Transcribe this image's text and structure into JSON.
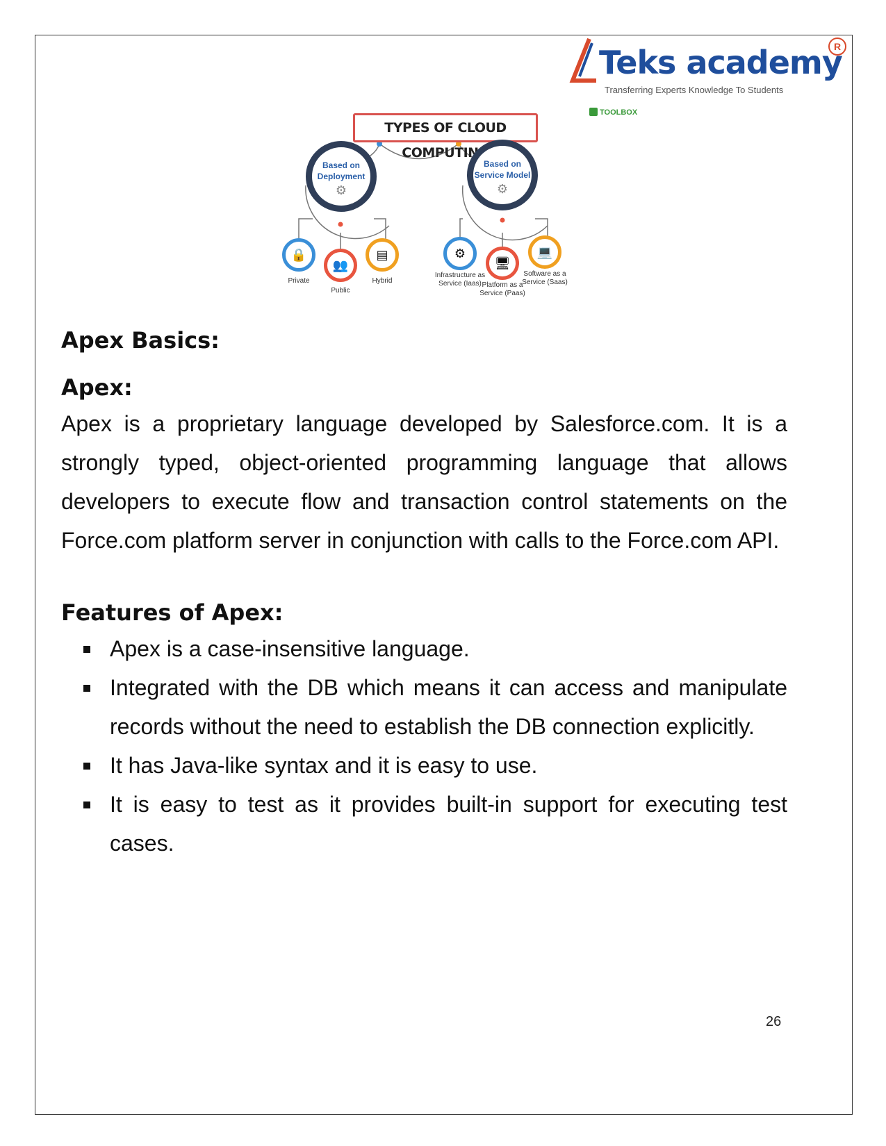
{
  "logo": {
    "name": "Teks academy",
    "tagline": "Transferring Experts Knowledge To Students",
    "registered": "R"
  },
  "figure": {
    "title": "TYPES OF CLOUD COMPUTING",
    "source": "TOOLBOX",
    "groups": [
      {
        "label": "Based on Deployment",
        "icon": "gear-icon",
        "items": [
          {
            "label": "Private",
            "icon": "lock-icon",
            "color": "#3a8fd8"
          },
          {
            "label": "Public",
            "icon": "people-icon",
            "color": "#e8553f"
          },
          {
            "label": "Hybrid",
            "icon": "server-icon",
            "color": "#f0a020"
          }
        ]
      },
      {
        "label": "Based on Service Model",
        "icon": "gear-icon",
        "items": [
          {
            "label": "Infrastructure as Service (Iaas)",
            "icon": "cog-icon",
            "color": "#3a8fd8"
          },
          {
            "label": "Platform as a Service (Paas)",
            "icon": "monitor-icon",
            "color": "#e8553f"
          },
          {
            "label": "Software as a Service (Saas)",
            "icon": "laptop-icon",
            "color": "#f0a020"
          }
        ]
      }
    ]
  },
  "section_title": "Apex Basics:",
  "apex_heading": "Apex:",
  "apex_paragraph": "Apex is a proprietary language developed by Salesforce.com. It is a strongly typed, object-oriented programming language that allows developers to execute flow and transaction control statements on the Force.com platform server in conjunction with calls to the Force.com API.",
  "features_heading": "Features of Apex:",
  "features": [
    "Apex is a case-insensitive language.",
    "Integrated with the DB which means it can access and manipulate records without the need to establish the DB connection explicitly.",
    "It has Java-like syntax and it is easy to use.",
    "It is easy to test as it provides built-in support for executing test cases."
  ],
  "page_number": "26"
}
